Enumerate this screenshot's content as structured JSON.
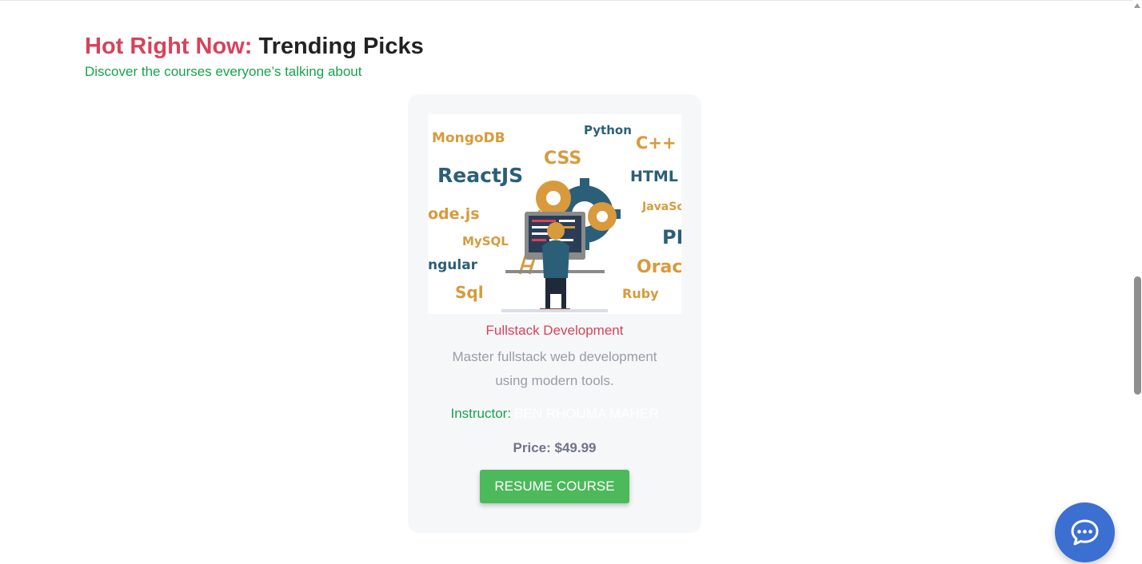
{
  "section": {
    "heading_highlight": "Hot Right Now:",
    "heading_rest": "Trending Picks",
    "subheading": "Discover the courses everyone’s talking about"
  },
  "course": {
    "image_words": [
      "MongoDB",
      "Python",
      "C++",
      "CSS",
      "ReactJS",
      "HTML",
      "ode.js",
      "JavaSc",
      "MySQL",
      "PH",
      "ngular",
      "Oracl",
      "Sql",
      "Ruby"
    ],
    "title": "Fullstack Development",
    "description": "Master fullstack web development using modern tools.",
    "instructor_label": "Instructor:",
    "instructor_name": "BEN RHOUMA MAHER",
    "price": "Price: $49.99",
    "button_label": "RESUME COURSE"
  },
  "chat": {
    "icon": "chat-bubble-icon"
  },
  "colors": {
    "accent_red": "#d9425a",
    "accent_green": "#17a34a",
    "button_green": "#4cb95a",
    "chat_blue": "#3b6fd1",
    "word_orange": "#d89a3c",
    "word_teal": "#2b5f78"
  }
}
